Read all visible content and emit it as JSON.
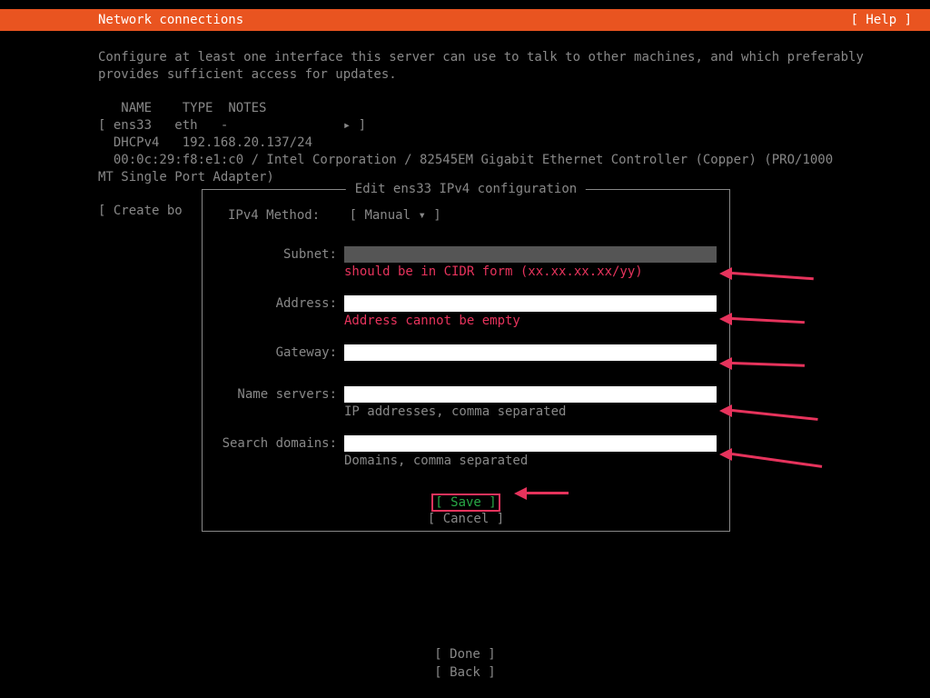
{
  "header": {
    "title": "Network connections",
    "help": "Help"
  },
  "description": "Configure at least one interface this server can use to talk to other machines, and which preferably provides sufficient access for updates.",
  "iface": {
    "col_name": "NAME",
    "col_type": "TYPE",
    "col_notes": "NOTES",
    "row1_left": "[ ens33   eth   -",
    "row1_right": "▸ ]",
    "row2": "  DHCPv4   192.168.20.137/24",
    "row3": "  00:0c:29:f8:e1:c0 / Intel Corporation / 82545EM Gigabit Ethernet Controller (Copper) (PRO/1000 MT Single Port Adapter)",
    "create": "[ Create bo"
  },
  "dialog": {
    "title": "Edit ens33 IPv4 configuration",
    "method_label": "IPv4 Method:",
    "method_value": "[ Manual           ▾ ]",
    "fields": {
      "subnet": {
        "label": "Subnet:",
        "value": "",
        "hint": "should be in CIDR form (xx.xx.xx.xx/yy)",
        "hint_err": true
      },
      "address": {
        "label": "Address:",
        "value": "",
        "hint": "Address cannot be empty",
        "hint_err": true
      },
      "gateway": {
        "label": "Gateway:",
        "value": "",
        "hint": ""
      },
      "nameservers": {
        "label": "Name servers:",
        "value": "",
        "hint": "IP addresses, comma separated"
      },
      "searchdomains": {
        "label": "Search domains:",
        "value": "",
        "hint": "Domains, comma separated"
      }
    },
    "buttons": {
      "save": "[ Save       ]",
      "cancel": "[ Cancel     ]"
    }
  },
  "bottom": {
    "done": "[ Done       ]",
    "back": "[ Back       ]"
  }
}
